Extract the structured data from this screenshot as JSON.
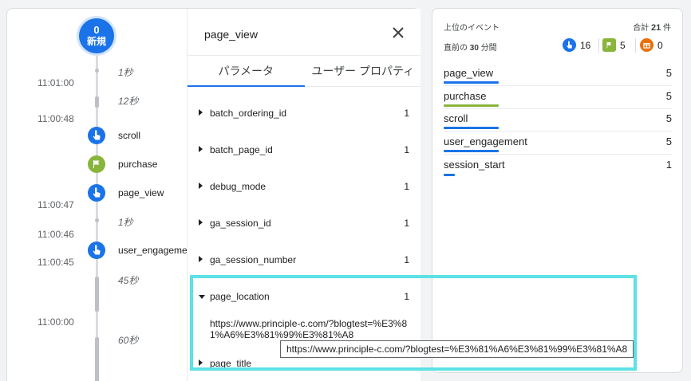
{
  "timeline": {
    "new_badge": {
      "count": "0",
      "label": "新規"
    },
    "times": [
      "11:01:00",
      "11:00:48",
      "11:00:47",
      "11:00:46",
      "11:00:45",
      "11:00:00"
    ],
    "durations": [
      "1秒",
      "12秒",
      "1秒",
      "45秒",
      "60秒"
    ],
    "events": [
      {
        "label": "scroll",
        "icon": "touch-icon",
        "color": "#1a73e8"
      },
      {
        "label": "purchase",
        "icon": "flag-icon",
        "color": "#8ab53c"
      },
      {
        "label": "page_view",
        "icon": "touch-icon",
        "color": "#1a73e8"
      },
      {
        "label": "user_engagement",
        "icon": "touch-icon",
        "color": "#1a73e8"
      }
    ]
  },
  "details": {
    "title": "page_view",
    "tabs": [
      "パラメータ",
      "ユーザー プロパティ"
    ],
    "params": [
      {
        "name": "batch_ordering_id",
        "count": "1"
      },
      {
        "name": "batch_page_id",
        "count": "1"
      },
      {
        "name": "debug_mode",
        "count": "1"
      },
      {
        "name": "ga_session_id",
        "count": "1"
      },
      {
        "name": "ga_session_number",
        "count": "1"
      },
      {
        "name": "page_location",
        "count": "1"
      },
      {
        "name": "page_title",
        "count": ""
      }
    ],
    "page_location_value": "https://www.principle-c.com/?blogtest=%E3%81%A6%E3%81%99%E3%81%A8",
    "tooltip": "https://www.principle-c.com/?blogtest=%E3%81%A6%E3%81%99%E3%81%A8"
  },
  "top_events": {
    "title": "上位のイベント",
    "total_prefix": "合計",
    "total_value": "21",
    "total_suffix": "件",
    "recent_prefix": "直前の",
    "recent_value": "30",
    "recent_suffix": "分間",
    "counters": [
      {
        "icon": "touch-icon",
        "color": "#1a73e8",
        "value": "16"
      },
      {
        "icon": "flag-icon",
        "color": "#8ab53c",
        "value": "5"
      },
      {
        "icon": "gift-icon",
        "color": "#e8710a",
        "value": "0"
      }
    ],
    "rows": [
      {
        "name": "page_view",
        "value": "5",
        "bar_fraction": 0.24,
        "color": "#1a73e8"
      },
      {
        "name": "purchase",
        "value": "5",
        "bar_fraction": 0.24,
        "color": "#8ab53c"
      },
      {
        "name": "scroll",
        "value": "5",
        "bar_fraction": 0.24,
        "color": "#1a73e8"
      },
      {
        "name": "user_engagement",
        "value": "5",
        "bar_fraction": 0.24,
        "color": "#1a73e8"
      },
      {
        "name": "session_start",
        "value": "1",
        "bar_fraction": 0.05,
        "color": "#1a73e8"
      }
    ]
  }
}
